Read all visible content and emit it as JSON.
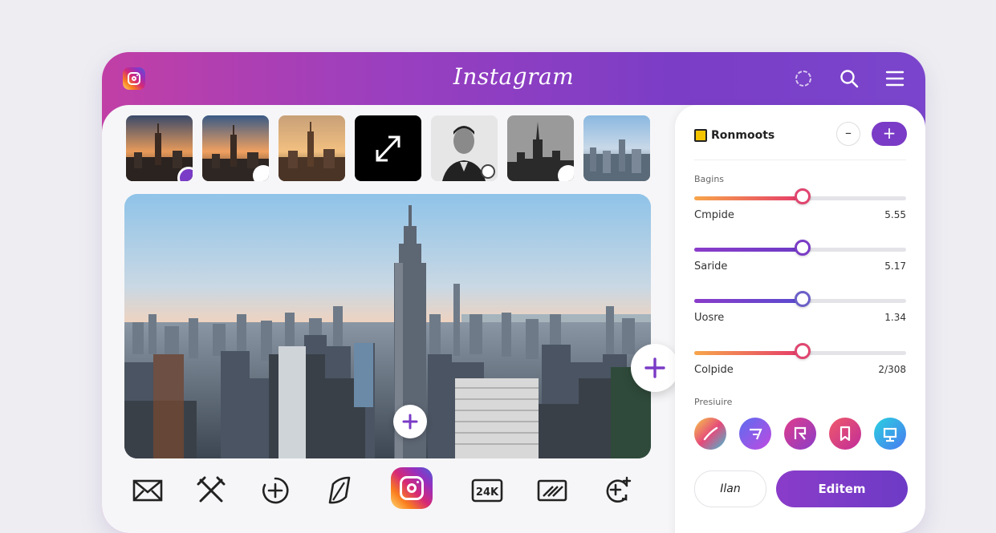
{
  "app": {
    "title": "Instagram"
  },
  "topbar": {
    "icons": [
      "instagram-logo-icon",
      "ring-icon",
      "search-icon",
      "menu-icon"
    ]
  },
  "thumbnails": [
    {
      "name": "city-skyline-dusk",
      "badge": "heart-badge"
    },
    {
      "name": "city-skyline-sunset",
      "badge": "corner-badge"
    },
    {
      "name": "city-skyline-golden",
      "badge": ""
    },
    {
      "name": "expand-tile",
      "badge": ""
    },
    {
      "name": "portrait-man",
      "badge": "small-badge"
    },
    {
      "name": "city-silhouette",
      "badge": "corner-badge"
    },
    {
      "name": "city-skyline-blue",
      "badge": ""
    }
  ],
  "panel": {
    "title": "Ronmoots",
    "add_label": "+",
    "minus_label": "–",
    "section_label": "Bagins",
    "sliders": [
      {
        "label": "Cmpide",
        "value": "5.55",
        "level": 0.51,
        "gradient": [
          "#f7a64a",
          "#e53a6a"
        ],
        "ring": "#e0456f"
      },
      {
        "label": "Saride",
        "value": "5.17",
        "level": 0.51,
        "gradient": [
          "#8a3cc9",
          "#6d3bc6"
        ],
        "ring": "#7a3bc6"
      },
      {
        "label": "Uosre",
        "value": "1.34",
        "level": 0.51,
        "gradient": [
          "#8a3cc9",
          "#5a4ad0"
        ],
        "ring": "#6b5fc8"
      },
      {
        "label": "Colpide",
        "value": "2/308",
        "level": 0.51,
        "gradient": [
          "#f7a64a",
          "#e53a6a"
        ],
        "ring": "#e0456f"
      }
    ],
    "presets_label": "Presiuire",
    "presets": [
      {
        "name": "preset-rainbow",
        "colors": [
          "#f7c948",
          "#e54a7a",
          "#3ac0d8"
        ]
      },
      {
        "name": "preset-violet",
        "colors": [
          "#5b6df0",
          "#c04ae0"
        ]
      },
      {
        "name": "preset-magenta",
        "colors": [
          "#e03c8a",
          "#8a3cc9"
        ]
      },
      {
        "name": "preset-pink",
        "colors": [
          "#f05a6a",
          "#c02c9a"
        ]
      },
      {
        "name": "preset-cyan",
        "colors": [
          "#2ad0e0",
          "#4a7af0"
        ]
      }
    ],
    "secondary_button": "Ilan",
    "primary_button": "Editem"
  },
  "toolbar": {
    "icons": [
      "mail-icon",
      "crossed-tools-icon",
      "add-circle-icon",
      "leaf-icon",
      "instagram-icon",
      "24k-icon",
      "hatch-icon",
      "refresh-add-icon"
    ],
    "badge_24k": "24K"
  },
  "colors": {
    "accent": "#7a3bc6",
    "header_gradient_start": "#c13fa6",
    "header_gradient_end": "#7a45cc"
  }
}
